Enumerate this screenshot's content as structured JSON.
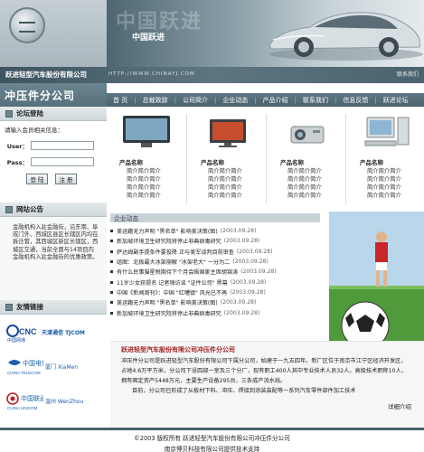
{
  "header": {
    "banner_slogan": "中国跃进",
    "banner_ghost": "中国跃进",
    "company_name": "跃进轻型汽车股份有限公司",
    "site_url": "HTTP://WWW.CHINAYJ.COM",
    "contact_links": "联系我们",
    "subtitle": "冲压件分公司"
  },
  "nav": [
    "首 页",
    "总裁致辞",
    "公司简介",
    "企业动态",
    "产品介绍",
    "联系我们",
    "信息反馈",
    "跃进论坛"
  ],
  "login": {
    "title": "论坛登陆",
    "hint": "请输入会员相关信息：",
    "user_label": "User：",
    "pass_label": "Pass：",
    "login_button": "登 陆",
    "register_button": "注 册"
  },
  "notice": {
    "title": "网站公告",
    "text": "金融机构入驻金融街，沿东南、阜成门外、西城区县区长辖区内均在拆迁管，其西城区新区长辖区，西城区交通，当前全面与14项目内金融机构入驻金融街的优惠政策。"
  },
  "links": {
    "title": "友情链接",
    "brands": [
      {
        "name": "CNC",
        "cn": "中国网通",
        "extra": "天津通信 TJCOM"
      },
      {
        "name": "中国电信",
        "cn": "CHINA TELECOM",
        "extra": "厦门 XiaMen"
      },
      {
        "name": "中国联通",
        "cn": "CHINA UNICOM",
        "extra": "温州 WenZhou"
      }
    ]
  },
  "products": [
    {
      "title": "产品名称",
      "lines": [
        "简介简介简介",
        "简介简介简介",
        "简介简介简介",
        "简介简介简介"
      ],
      "icon": "tv-icon"
    },
    {
      "title": "产品名称",
      "lines": [
        "简介简介简介",
        "简介简介简介",
        "简介简介简介",
        "简介简介简介"
      ],
      "icon": "monitor-icon"
    },
    {
      "title": "产品名称",
      "lines": [
        "简介简介简介",
        "简介简介简介",
        "简介简介简介",
        "简介简介简介"
      ],
      "icon": "projector-icon"
    },
    {
      "title": "产品名称",
      "lines": [
        "简介简介简介",
        "简介简介简介",
        "简介简介简介",
        "简介简介简介"
      ],
      "icon": "computer-icon"
    }
  ],
  "news": {
    "title": "企业动态",
    "more": "more",
    "items": [
      {
        "text": "美运籍无力声明 \"黑名单\" 影响美决策(图)",
        "date": "(2003.09.28)"
      },
      {
        "text": "新加坡环境卫生研究院将停止非典病毒研究",
        "date": "(2003.09.28)"
      },
      {
        "text": "萨达姆副手提条件要投降 正与美军谈判目前审查",
        "date": "(2003.09.28)"
      },
      {
        "text": "组图：北极最大冰架崩解 \"冰架老大\" 一分为二",
        "date": "(2003.09.28)"
      },
      {
        "text": "有什么民事猫星税期待下个月会晤国家主席胡锦涛",
        "date": "(2003.09.28)"
      },
      {
        "text": "11岁少女获提名 记者嗨访谈 \"证件公司\" 黑幕",
        "date": "(2003.09.28)"
      },
      {
        "text": "中国《新闻周刊》：中国 \"红嘈镇\" 风光已不再",
        "date": "(2003.09.28)"
      },
      {
        "text": "美运籍无力声明 \"黑名单\" 影响美决策(图)",
        "date": "(2003.09.28)"
      },
      {
        "text": "新加坡环境卫生研究院将停止非典病毒研究",
        "date": "(2003.09.28)"
      }
    ]
  },
  "intro": {
    "title": "跃进轻型汽车股份有限公司冲压件分公司",
    "text": "冲压件分公司是跃进轻型汽车股份有限公司下属分公司，始建于一九五四年。新厂区位于南京市江宁区经济开发区，占地4.6万平方米，分公司下设四部一室及三个分厂，现有职工400人其中专业技术人员32人，高级技术职称10人，拥有固定资产5448万元，主要生产设备295台，三条成产流水线。",
    "text2": "目前，分公司已形成了从板材下料、冲压、焊接到涂装装配等一系列汽车零件部件加工技术",
    "more": "详细介绍"
  },
  "footer": {
    "copyright": "©2003 版权所有 跃进轻型汽车股份有限公司冲压件分公司",
    "support": "南京博贝科技有限公司提供技术支持"
  }
}
